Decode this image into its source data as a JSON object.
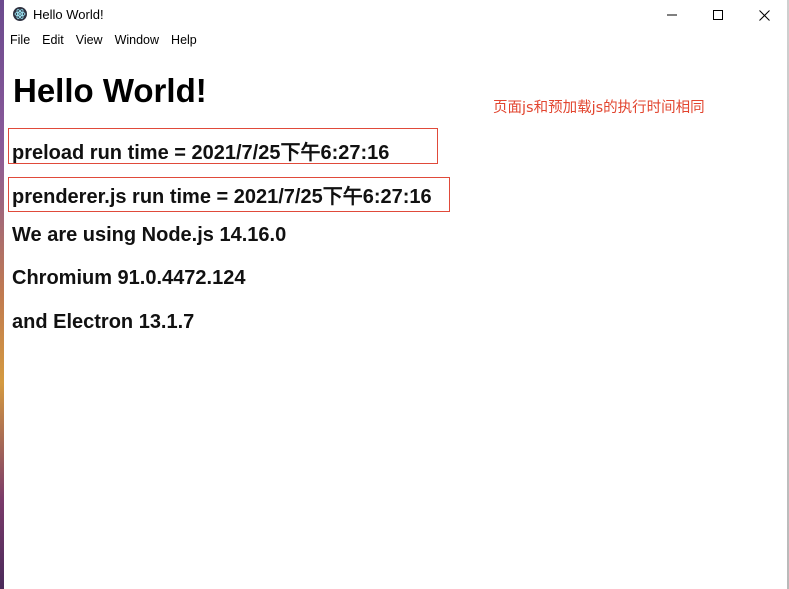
{
  "window": {
    "title": "Hello World!",
    "icon": "electron-icon"
  },
  "window_controls": {
    "minimize_icon": "minimize-icon",
    "maximize_icon": "maximize-icon",
    "close_icon": "close-icon"
  },
  "menu": {
    "items": [
      "File",
      "Edit",
      "View",
      "Window",
      "Help"
    ]
  },
  "page": {
    "heading": "Hello World!",
    "lines": [
      "preload run time = 2021/7/25下午6:27:16",
      "prenderer.js run time = 2021/7/25下午6:27:16",
      "We are using Node.js 14.16.0",
      "Chromium 91.0.4472.124",
      "and Electron 13.1.7"
    ],
    "annotation": "页面js和预加载js的执行时间相同"
  },
  "colors": {
    "annotation": "#e2452f",
    "highlight_border": "#e04a3a"
  }
}
